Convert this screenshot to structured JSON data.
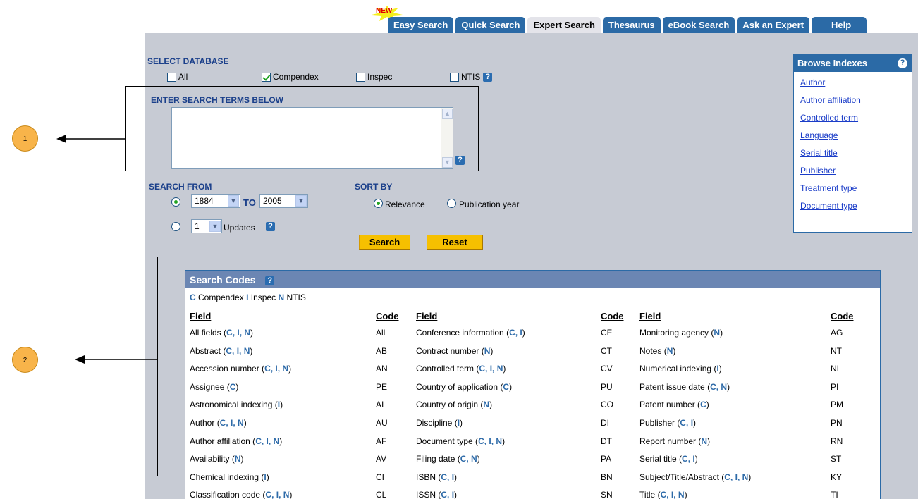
{
  "badge_new": "NEW",
  "tabs": [
    {
      "label": "Easy Search",
      "active": false
    },
    {
      "label": "Quick Search",
      "active": false
    },
    {
      "label": "Expert Search",
      "active": true
    },
    {
      "label": "Thesaurus",
      "active": false
    },
    {
      "label": "eBook Search",
      "active": false
    },
    {
      "label": "Ask an Expert",
      "active": false
    },
    {
      "label": "Help",
      "active": false
    }
  ],
  "select_database": {
    "label": "SELECT DATABASE",
    "options": [
      {
        "label": "All",
        "checked": false
      },
      {
        "label": "Compendex",
        "checked": true
      },
      {
        "label": "Inspec",
        "checked": false
      },
      {
        "label": "NTIS",
        "checked": false
      }
    ]
  },
  "search_terms": {
    "label": "ENTER SEARCH TERMS BELOW",
    "value": ""
  },
  "search_from": {
    "label": "SEARCH FROM",
    "from_year": "1884",
    "to_label": "TO",
    "to_year": "2005",
    "updates_value": "1",
    "updates_label": "Updates"
  },
  "sort_by": {
    "label": "SORT BY",
    "options": [
      {
        "label": "Relevance",
        "selected": true
      },
      {
        "label": "Publication year",
        "selected": false
      }
    ]
  },
  "buttons": {
    "search": "Search",
    "reset": "Reset"
  },
  "browse_indexes": {
    "title": "Browse Indexes",
    "links": [
      "Author",
      "Author affiliation",
      "Controlled term",
      "Language",
      "Serial title",
      "Publisher",
      "Treatment type",
      "Document type"
    ]
  },
  "search_codes": {
    "title": "Search Codes",
    "legend": [
      {
        "code": "C",
        "name": "Compendex"
      },
      {
        "code": "I",
        "name": "Inspec"
      },
      {
        "code": "N",
        "name": "NTIS"
      }
    ],
    "header_field": "Field",
    "header_code": "Code",
    "columns": [
      [
        {
          "field": "All fields",
          "dbs": "C, I, N",
          "code": "All"
        },
        {
          "field": "Abstract",
          "dbs": "C, I, N",
          "code": "AB"
        },
        {
          "field": "Accession number",
          "dbs": "C, I, N",
          "code": "AN"
        },
        {
          "field": "Assignee",
          "dbs": "C",
          "code": "PE"
        },
        {
          "field": "Astronomical indexing",
          "dbs": "I",
          "code": "AI"
        },
        {
          "field": "Author",
          "dbs": "C, I, N",
          "code": "AU"
        },
        {
          "field": "Author affiliation",
          "dbs": "C, I, N",
          "code": "AF"
        },
        {
          "field": "Availability",
          "dbs": "N",
          "code": "AV"
        },
        {
          "field": "Chemical indexing",
          "dbs": "I",
          "code": "CI"
        },
        {
          "field": "Classification code",
          "dbs": "C, I, N",
          "code": "CL"
        }
      ],
      [
        {
          "field": "Conference information",
          "dbs": "C, I",
          "code": "CF"
        },
        {
          "field": "Contract number",
          "dbs": "N",
          "code": "CT"
        },
        {
          "field": "Controlled term",
          "dbs": "C, I, N",
          "code": "CV"
        },
        {
          "field": "Country of application",
          "dbs": "C",
          "code": "PU"
        },
        {
          "field": "Country of origin",
          "dbs": "N",
          "code": "CO"
        },
        {
          "field": "Discipline",
          "dbs": "I",
          "code": "DI"
        },
        {
          "field": "Document type",
          "dbs": "C, I, N",
          "code": "DT"
        },
        {
          "field": "Filing date",
          "dbs": "C, N",
          "code": "PA"
        },
        {
          "field": "ISBN",
          "dbs": "C, I",
          "code": "BN"
        },
        {
          "field": "ISSN",
          "dbs": "C, I",
          "code": "SN"
        }
      ],
      [
        {
          "field": "Monitoring agency",
          "dbs": "N",
          "code": "AG"
        },
        {
          "field": "Notes",
          "dbs": "N",
          "code": "NT"
        },
        {
          "field": "Numerical indexing",
          "dbs": "I",
          "code": "NI"
        },
        {
          "field": "Patent issue date",
          "dbs": "C, N",
          "code": "PI"
        },
        {
          "field": "Patent number",
          "dbs": "C",
          "code": "PM"
        },
        {
          "field": "Publisher",
          "dbs": "C, I",
          "code": "PN"
        },
        {
          "field": "Report number",
          "dbs": "N",
          "code": "RN"
        },
        {
          "field": "Serial title",
          "dbs": "C, I",
          "code": "ST"
        },
        {
          "field": "Subject/Title/Abstract",
          "dbs": "C, I, N",
          "code": "KY"
        },
        {
          "field": "Title",
          "dbs": "C, I, N",
          "code": "TI"
        }
      ]
    ]
  },
  "callouts": [
    "1",
    "2"
  ],
  "colors": {
    "tab_blue": "#2b6aa6",
    "panel_grey": "#c7cbd4",
    "label_navy": "#1a3f8a",
    "button_gold": "#f6c000",
    "callout_orange": "#f8b44a"
  }
}
